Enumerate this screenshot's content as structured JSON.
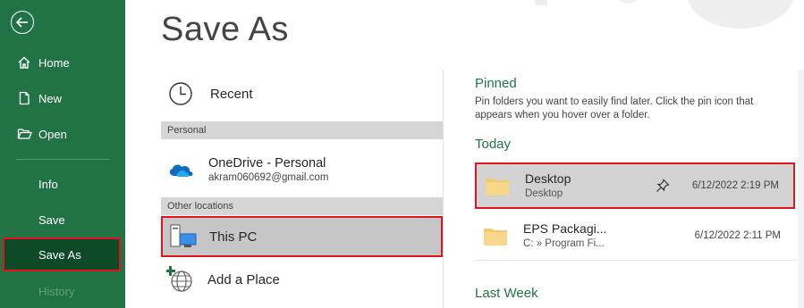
{
  "sidebar": {
    "items": [
      {
        "label": "Home",
        "icon": "home-icon"
      },
      {
        "label": "New",
        "icon": "new-document-icon"
      },
      {
        "label": "Open",
        "icon": "open-folder-icon"
      },
      {
        "label": "Info"
      },
      {
        "label": "Save"
      },
      {
        "label": "Save As",
        "active": true
      },
      {
        "label": "History",
        "disabled": true
      }
    ]
  },
  "header": {
    "title": "Save As"
  },
  "locations": {
    "recent": "Recent",
    "personal_header": "Personal",
    "onedrive": {
      "name": "OneDrive - Personal",
      "email": "akram060692@gmail.com"
    },
    "other_header": "Other locations",
    "this_pc": "This PC",
    "add_place": "Add a Place"
  },
  "pinned": {
    "title": "Pinned",
    "description": "Pin folders you want to easily find later. Click the pin icon that appears when you hover over a folder."
  },
  "today": {
    "title": "Today",
    "folders": [
      {
        "name": "Desktop",
        "path": "Desktop",
        "date": "6/12/2022 2:19 PM"
      },
      {
        "name": "EPS Packagi...",
        "path": "C: » Program Fi...",
        "date": "6/12/2022 2:11 PM"
      }
    ]
  },
  "last_week": {
    "title": "Last Week"
  },
  "colors": {
    "accent": "#217346",
    "highlight": "#e0141e"
  }
}
